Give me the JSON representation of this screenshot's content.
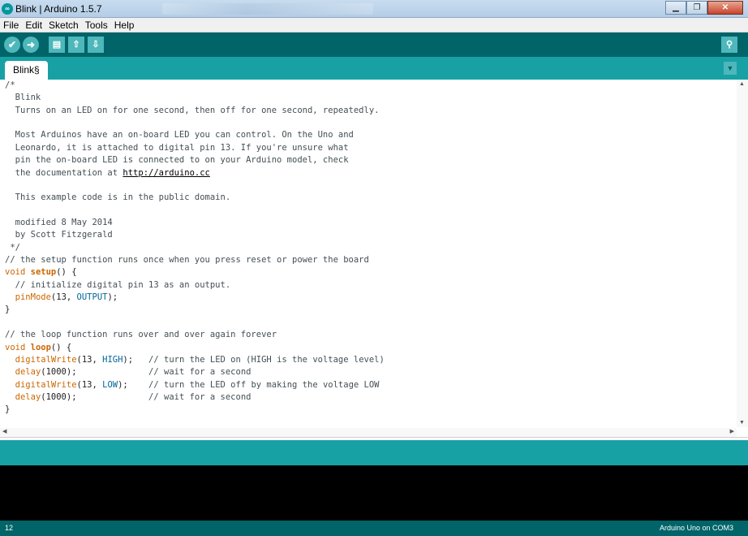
{
  "window": {
    "title": "Blink | Arduino 1.5.7",
    "app_icon_text": "∞",
    "controls": {
      "minimize": "▁",
      "maximize": "❐",
      "close": "✕"
    }
  },
  "menu": {
    "items": [
      "File",
      "Edit",
      "Sketch",
      "Tools",
      "Help"
    ]
  },
  "toolbar": {
    "verify_icon": "✔",
    "upload_icon": "➜",
    "new_icon": "▤",
    "open_icon": "⇧",
    "save_icon": "⇩",
    "serial_monitor_icon": "⚲"
  },
  "tabs": {
    "active": "Blink§",
    "menu_icon": "▼"
  },
  "editor": {
    "lines": [
      [
        {
          "t": "/*",
          "c": "comment"
        }
      ],
      [
        {
          "t": "  Blink",
          "c": "comment"
        }
      ],
      [
        {
          "t": "  Turns on an LED on for one second, then off for one second, repeatedly.",
          "c": "comment"
        }
      ],
      [
        {
          "t": "",
          "c": "comment"
        }
      ],
      [
        {
          "t": "  Most Arduinos have an on-board LED you can control. On the Uno and",
          "c": "comment"
        }
      ],
      [
        {
          "t": "  Leonardo, it is attached to digital pin 13. If you're unsure what",
          "c": "comment"
        }
      ],
      [
        {
          "t": "  pin the on-board LED is connected to on your Arduino model, check",
          "c": "comment"
        }
      ],
      [
        {
          "t": "  the documentation at ",
          "c": "comment"
        },
        {
          "t": "http://arduino.cc",
          "c": "link"
        }
      ],
      [
        {
          "t": "",
          "c": "comment"
        }
      ],
      [
        {
          "t": "  This example code is in the public domain.",
          "c": "comment"
        }
      ],
      [
        {
          "t": "",
          "c": "comment"
        }
      ],
      [
        {
          "t": "  modified 8 May 2014",
          "c": "comment"
        }
      ],
      [
        {
          "t": "  by Scott Fitzgerald",
          "c": "comment"
        }
      ],
      [
        {
          "t": " */",
          "c": "comment"
        }
      ],
      [
        {
          "t": "// the setup function runs once when you press reset or power the board",
          "c": "comment"
        }
      ],
      [
        {
          "t": "void",
          "c": "kw"
        },
        {
          "t": " ",
          "c": ""
        },
        {
          "t": "setup",
          "c": "kw-b"
        },
        {
          "t": "() {",
          "c": ""
        }
      ],
      [
        {
          "t": "  // initialize digital pin 13 as an output.",
          "c": "comment"
        }
      ],
      [
        {
          "t": "  ",
          "c": ""
        },
        {
          "t": "pinMode",
          "c": "kw"
        },
        {
          "t": "(13, ",
          "c": ""
        },
        {
          "t": "OUTPUT",
          "c": "const"
        },
        {
          "t": ");",
          "c": ""
        }
      ],
      [
        {
          "t": "}",
          "c": ""
        }
      ],
      [
        {
          "t": "",
          "c": ""
        }
      ],
      [
        {
          "t": "// the loop function runs over and over again forever",
          "c": "comment"
        }
      ],
      [
        {
          "t": "void",
          "c": "kw"
        },
        {
          "t": " ",
          "c": ""
        },
        {
          "t": "loop",
          "c": "kw-b"
        },
        {
          "t": "() {",
          "c": ""
        }
      ],
      [
        {
          "t": "  ",
          "c": ""
        },
        {
          "t": "digitalWrite",
          "c": "kw"
        },
        {
          "t": "(13, ",
          "c": ""
        },
        {
          "t": "HIGH",
          "c": "const"
        },
        {
          "t": ");   ",
          "c": ""
        },
        {
          "t": "// turn the LED on (HIGH is the voltage level)",
          "c": "comment"
        }
      ],
      [
        {
          "t": "  ",
          "c": ""
        },
        {
          "t": "delay",
          "c": "kw"
        },
        {
          "t": "(1000);              ",
          "c": ""
        },
        {
          "t": "// wait for a second",
          "c": "comment"
        }
      ],
      [
        {
          "t": "  ",
          "c": ""
        },
        {
          "t": "digitalWrite",
          "c": "kw"
        },
        {
          "t": "(13, ",
          "c": ""
        },
        {
          "t": "LOW",
          "c": "const"
        },
        {
          "t": ");    ",
          "c": ""
        },
        {
          "t": "// turn the LED off by making the voltage LOW",
          "c": "comment"
        }
      ],
      [
        {
          "t": "  ",
          "c": ""
        },
        {
          "t": "delay",
          "c": "kw"
        },
        {
          "t": "(1000);              ",
          "c": ""
        },
        {
          "t": "// wait for a second",
          "c": "comment"
        }
      ],
      [
        {
          "t": "}",
          "c": ""
        }
      ]
    ]
  },
  "scrollbars": {
    "up": "▲",
    "down": "▼",
    "left": "◀",
    "right": "▶"
  },
  "footer": {
    "line_number": "12",
    "board": "Arduino Uno on COM3"
  },
  "colors": {
    "toolbar_dark": "#006468",
    "toolbar_light": "#17a1a5",
    "button": "#4db7bb",
    "keyword": "#cc6600",
    "constant": "#006699",
    "comment": "#434f54"
  }
}
